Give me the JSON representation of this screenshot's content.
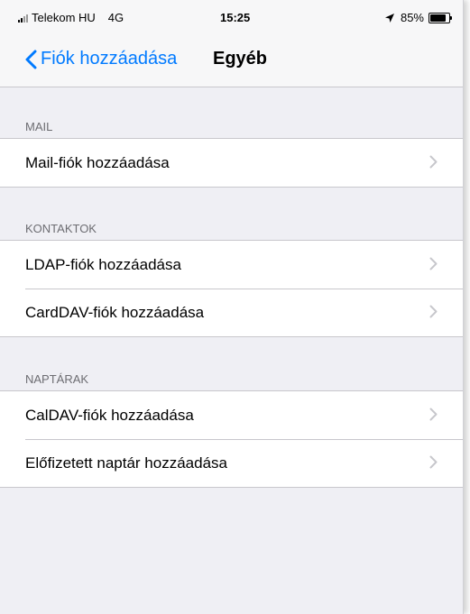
{
  "status_bar": {
    "carrier": "Telekom HU",
    "network": "4G",
    "time": "15:25",
    "battery_percent": "85%",
    "battery_level": 0.85,
    "icons": [
      "signal-icon",
      "location-arrow-icon",
      "battery-icon"
    ]
  },
  "nav": {
    "back_label": "Fiók hozzáadása",
    "title": "Egyéb"
  },
  "sections": [
    {
      "header": "MAIL",
      "rows": [
        {
          "label": "Mail-fiók hozzáadása"
        }
      ]
    },
    {
      "header": "KONTAKTOK",
      "rows": [
        {
          "label": "LDAP-fiók hozzáadása"
        },
        {
          "label": "CardDAV-fiók hozzáadása"
        }
      ]
    },
    {
      "header": "NAPTÁRAK",
      "rows": [
        {
          "label": "CalDAV-fiók hozzáadása"
        },
        {
          "label": "Előfizetett naptár hozzáadása"
        }
      ]
    }
  ],
  "colors": {
    "accent": "#007aff",
    "background": "#efeff4",
    "section_header": "#6d6d72",
    "separator": "#c8c7cc",
    "chevron": "#c7c7cc"
  }
}
